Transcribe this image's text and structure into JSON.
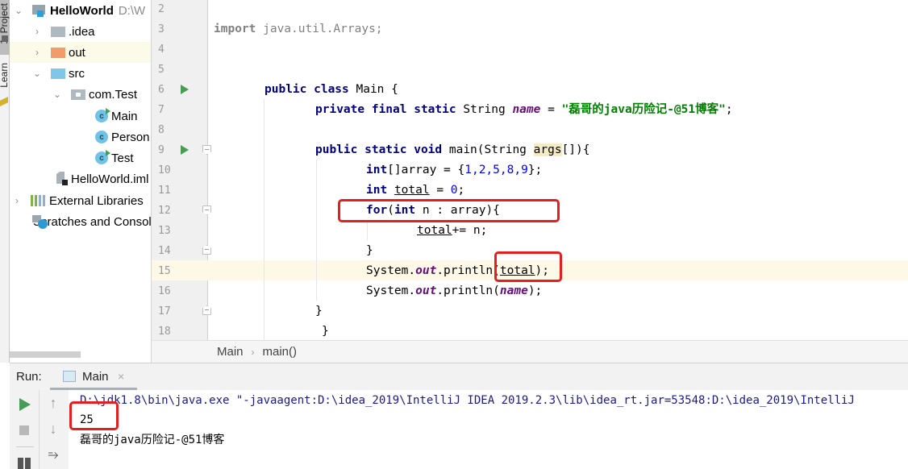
{
  "side_tabs": {
    "project": "1: Project",
    "learn": "Learn"
  },
  "project_tree": [
    {
      "label": "HelloWorld",
      "suffix": "D:\\W",
      "type": "module",
      "expanded": true
    },
    {
      "label": ".idea",
      "type": "folder-grey",
      "expanded": false
    },
    {
      "label": "out",
      "type": "folder-orange",
      "expanded": false,
      "selected": true
    },
    {
      "label": "src",
      "type": "folder-blue",
      "expanded": true
    },
    {
      "label": "com.Test",
      "type": "package",
      "expanded": true
    },
    {
      "label": "Main",
      "type": "class-runnable"
    },
    {
      "label": "Person",
      "type": "class"
    },
    {
      "label": "Test",
      "type": "class-runnable"
    },
    {
      "label": "HelloWorld.iml",
      "type": "iml"
    },
    {
      "label": "External Libraries",
      "type": "libraries",
      "expanded": false
    },
    {
      "label": "Scratches and Consoles",
      "type": "scratches"
    }
  ],
  "editor": {
    "line_numbers": [
      "2",
      "3",
      "4",
      "5",
      "6",
      "7",
      "8",
      "9",
      "10",
      "11",
      "12",
      "13",
      "14",
      "15",
      "16",
      "17",
      "18"
    ],
    "highlighted_line": "15",
    "code": {
      "l3_kw": "import",
      "l3_rest": " java.util.Arrays;",
      "l6_kw": "public class",
      "l6_rest": " Main {",
      "l7_kw": "private final static",
      "l7_type": " String ",
      "l7_field": "name",
      "l7_eq": " = ",
      "l7_str": "\"磊哥的java历险记-@51博客\"",
      "l7_end": ";",
      "l9_kw": "public static void",
      "l9_a": " main(String ",
      "l9_param": "args",
      "l9_b": "[]){",
      "l10_kw": "int",
      "l10_a": "[]array = {",
      "l10_nums": "1,2,5,8,9",
      "l10_b": "};",
      "l11_kw": "int",
      "l11_sp": " ",
      "l11_var": "total",
      "l11_a": " = ",
      "l11_num": "0",
      "l11_b": ";",
      "l12_kw1": "for",
      "l12_a": "(",
      "l12_kw2": "int",
      "l12_b": " n : array){",
      "l13_var": "total",
      "l13_a": "+= n;",
      "l14": "}",
      "l15_a": "System.",
      "l15_field": "out",
      "l15_b": ".println(",
      "l15_var": "total",
      "l15_c": ");",
      "l16_a": "System.",
      "l16_field": "out",
      "l16_b": ".println(",
      "l16_field2": "name",
      "l16_c": ");",
      "l17": "}",
      "l18": "}"
    }
  },
  "breadcrumbs": [
    "Main",
    "main()"
  ],
  "breadcrumb_sep": "›",
  "run_panel": {
    "label": "Run:",
    "tab_label": "Main",
    "tab_close": "×",
    "console": [
      "D:\\jdk1.8\\bin\\java.exe \"-javaagent:D:\\idea_2019\\IntelliJ IDEA 2019.2.3\\lib\\idea_rt.jar=53548:D:\\idea_2019\\IntelliJ",
      "25",
      "磊哥的java历险记-@51博客"
    ],
    "icons": {
      "up": "↑",
      "down": "↓",
      "wrap": "⥱"
    }
  },
  "colors": {
    "keyword": "#000080",
    "string": "#008000",
    "field": "#660e7a",
    "number": "#0000ff",
    "annotation_box": "#e61e1e",
    "run_green": "#499c54"
  }
}
